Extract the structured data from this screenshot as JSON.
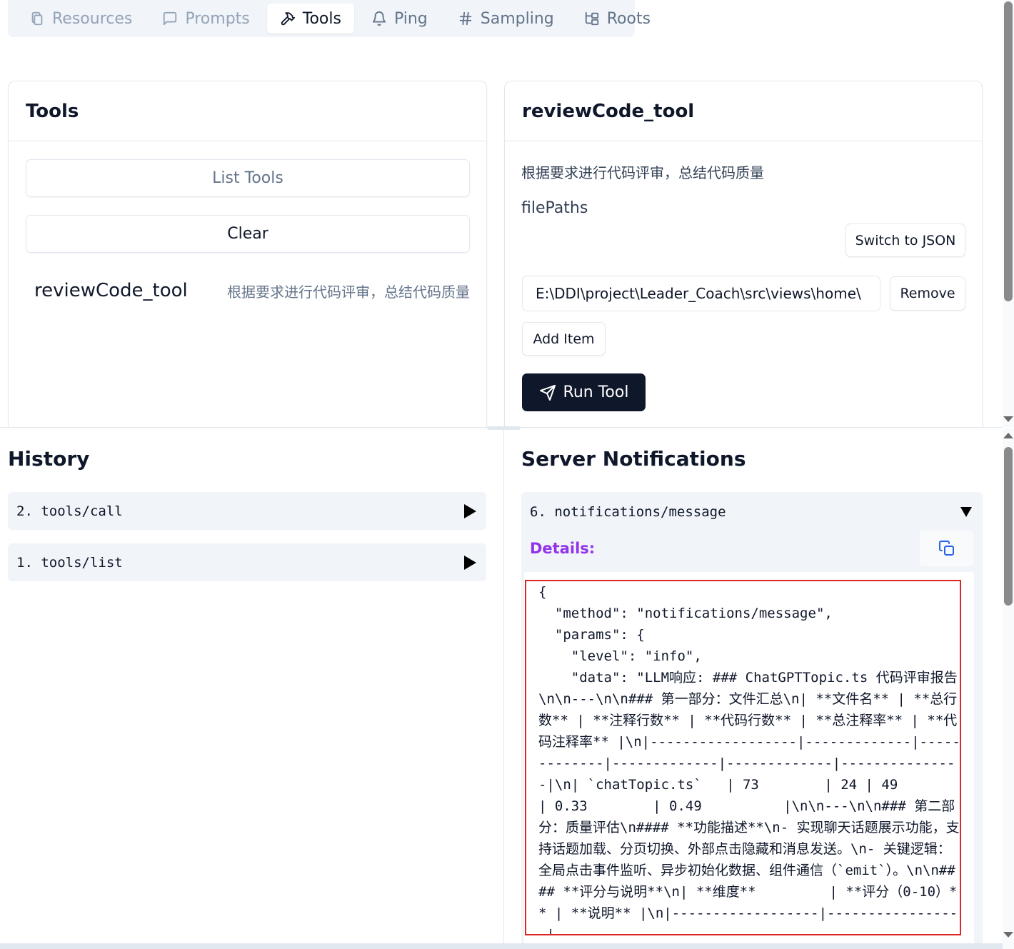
{
  "tabs": [
    {
      "label": "Resources",
      "icon": "files-icon"
    },
    {
      "label": "Prompts",
      "icon": "message-square-icon"
    },
    {
      "label": "Tools",
      "icon": "hammer-icon",
      "active": true
    },
    {
      "label": "Ping",
      "icon": "bell-icon"
    },
    {
      "label": "Sampling",
      "icon": "hash-icon"
    },
    {
      "label": "Roots",
      "icon": "folder-tree-icon"
    }
  ],
  "tools_panel": {
    "title": "Tools",
    "list_label": "List Tools",
    "clear_label": "Clear",
    "items": [
      {
        "name": "reviewCode_tool",
        "description": "根据要求进行代码评审，总结代码质量"
      }
    ]
  },
  "tool_detail": {
    "title": "reviewCode_tool",
    "description": "根据要求进行代码评审，总结代码质量",
    "param_name": "filePaths",
    "switch_json_label": "Switch to JSON",
    "path_value": "E:\\DDI\\project\\Leader_Coach\\src\\views\\home\\",
    "remove_label": "Remove",
    "add_item_label": "Add Item",
    "run_label": "Run Tool"
  },
  "history": {
    "title": "History",
    "items": [
      {
        "label": "2. tools/call"
      },
      {
        "label": "1. tools/list"
      }
    ]
  },
  "notifications": {
    "title": "Server Notifications",
    "item_label": "6. notifications/message",
    "details_label": "Details:",
    "json_text": "{\n  \"method\": \"notifications/message\",\n  \"params\": {\n    \"level\": \"info\",\n    \"data\": \"LLM响应: ### ChatGPTTopic.ts 代码评审报告\\n\\n---\\n\\n### 第一部分：文件汇总\\n| **文件名** | **总行数** | **注释行数** | **代码行数** | **总注释率** | **代码注释率** |\\n|------------------|-------------|-------------|-------------|-------------|---------------|\\n| `chatTopic.ts`   | 73        | 24 | 49          | 0.33        | 0.49          |\\n\\n---\\n\\n### 第二部分：质量评估\\n#### **功能描述**\\n- 实现聊天话题展示功能，支持话题加载、分页切换、外部点击隐藏和消息发送。\\n- 关键逻辑：全局点击事件监听、异步初始化数据、组件通信（`emit`）。\\n\\n#### **评分与说明**\\n| **维度**         | **评分（0-10）** | **说明** |\\n|------------------|-----------------|-------------"
  },
  "colors": {
    "accent_purple": "#9333ea",
    "run_button_bg": "#0f172a",
    "highlight_red": "#dc2626",
    "copy_icon": "#2563eb"
  }
}
